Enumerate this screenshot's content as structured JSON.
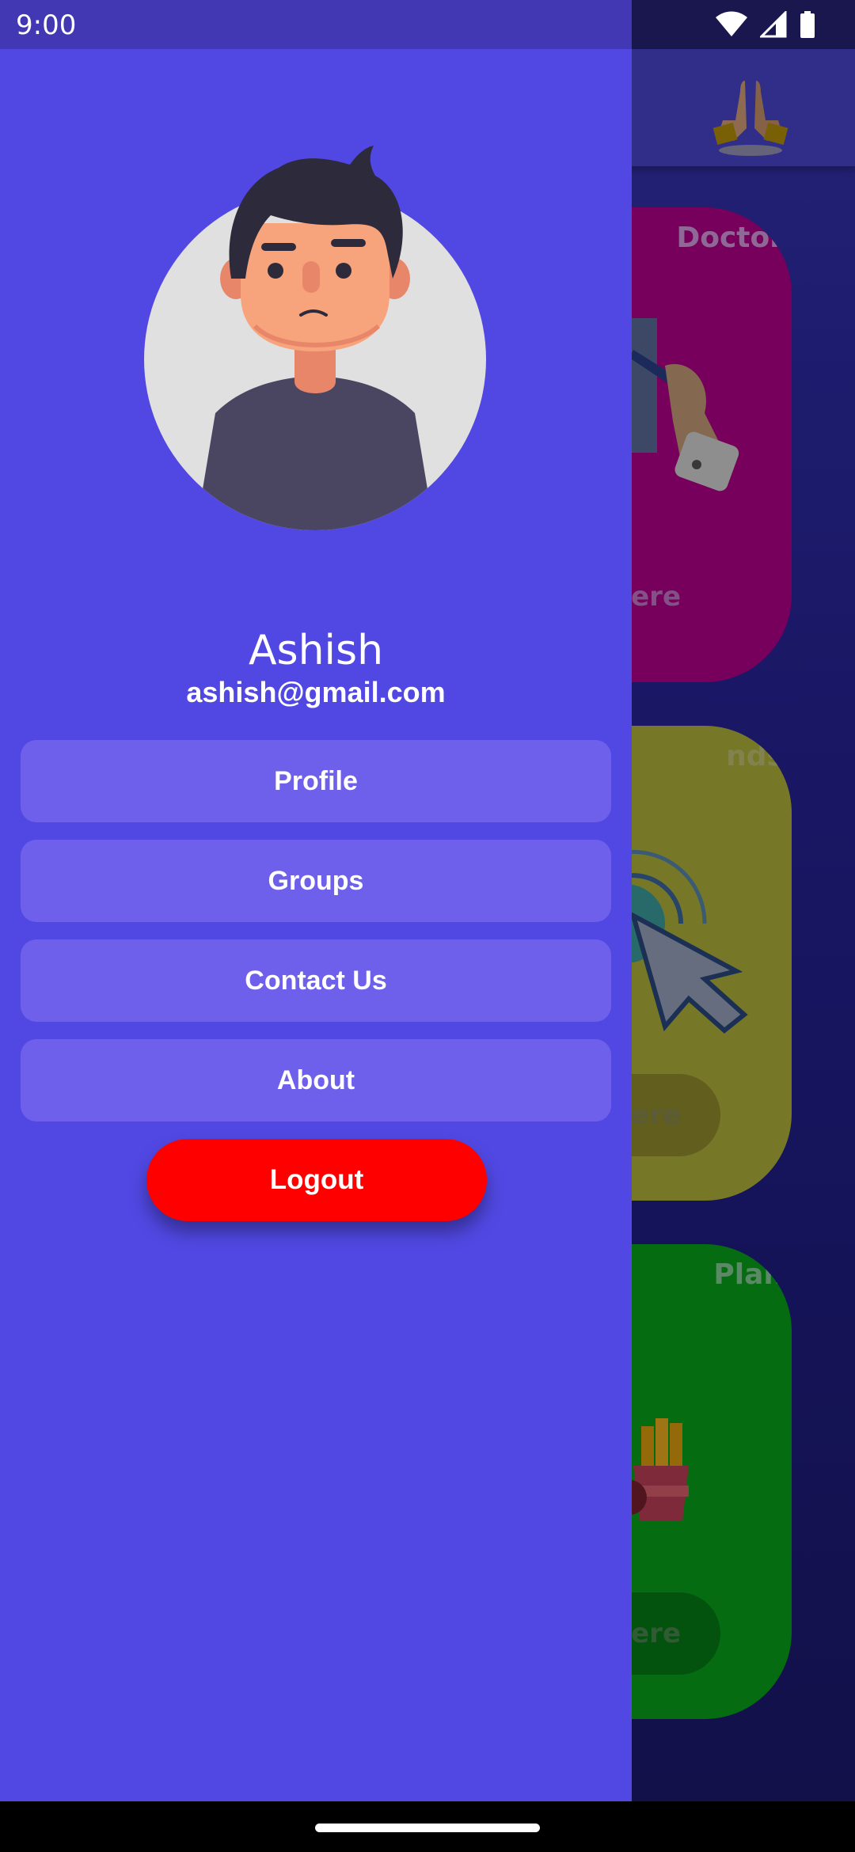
{
  "status_bar": {
    "time": "9:00",
    "icons": [
      "wifi-icon",
      "signal-icon",
      "battery-icon"
    ]
  },
  "drawer": {
    "avatar": "user-avatar-illustration",
    "user_name": "Ashish",
    "user_email": "ashish@gmail.com",
    "menu": {
      "profile_label": "Profile",
      "groups_label": "Groups",
      "contact_label": "Contact Us",
      "about_label": "About"
    },
    "logout_label": "Logout"
  },
  "background": {
    "appbar_icon": "folded-hands-icon",
    "cards": [
      {
        "title": "Doctor",
        "button": "Here"
      },
      {
        "title": "nds",
        "button": "Here"
      },
      {
        "title": "Plan",
        "button": "Here"
      }
    ]
  },
  "colors": {
    "drawer": "#5148e3",
    "menu_button": "#6e60ea",
    "logout": "#ff0000",
    "card_doctor": "#b3008c",
    "card_friends": "#b3b63d",
    "card_plan": "#08a41c"
  }
}
